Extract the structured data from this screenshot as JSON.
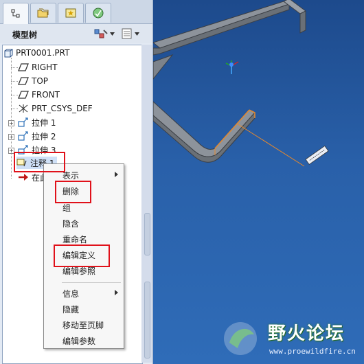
{
  "panel": {
    "title": "模型树"
  },
  "tree": {
    "root": "PRT0001.PRT",
    "items": [
      {
        "label": "RIGHT",
        "icon": "datum-plane-icon"
      },
      {
        "label": "TOP",
        "icon": "datum-plane-icon"
      },
      {
        "label": "FRONT",
        "icon": "datum-plane-icon"
      },
      {
        "label": "PRT_CSYS_DEF",
        "icon": "csys-icon"
      },
      {
        "label": "拉伸 1",
        "icon": "extrude-icon"
      },
      {
        "label": "拉伸 2",
        "icon": "extrude-icon"
      },
      {
        "label": "拉伸 3",
        "icon": "extrude-icon"
      },
      {
        "label": "注释 1",
        "icon": "note-icon"
      },
      {
        "label": "在此",
        "icon": "insert-here-icon"
      }
    ]
  },
  "menu": {
    "items": [
      {
        "label": "表示",
        "submenu": true
      },
      {
        "label": "删除"
      },
      {
        "label": "组"
      },
      {
        "label": "隐含"
      },
      {
        "label": "重命名"
      },
      {
        "label": "编辑定义"
      },
      {
        "label": "编辑参照"
      },
      {
        "label": "信息",
        "submenu": true
      },
      {
        "label": "隐藏"
      },
      {
        "label": "移动至页脚"
      },
      {
        "label": "编辑参数"
      }
    ]
  },
  "watermark": {
    "title": "野火论坛",
    "url": "www.proewildfire.cn"
  },
  "colors": {
    "highlight": "#e0111a",
    "selection": "#cfe0f7",
    "viewport_top": "#1d4a8c",
    "viewport_bottom": "#2f6cb8"
  }
}
